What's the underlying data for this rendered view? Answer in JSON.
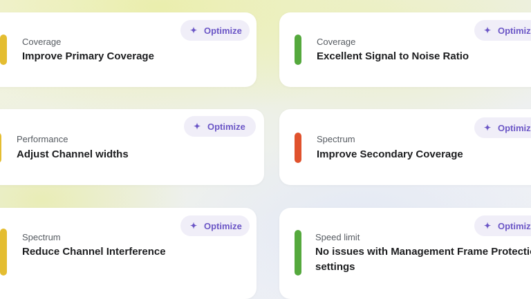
{
  "colors": {
    "yellow": "#e4bd31",
    "green": "#55a93d",
    "red": "#e0522d",
    "accent": "#6b56c6"
  },
  "optimize_icon": "sparkle-icon",
  "cards": [
    {
      "category": "Coverage",
      "title": "Improve Primary Coverage",
      "status": "yellow",
      "button": "Optimize"
    },
    {
      "category": "Coverage",
      "title": "Excellent Signal to Noise Ratio",
      "status": "green",
      "button": "Optimize"
    },
    {
      "category": "Performance",
      "title": "Adjust Channel widths",
      "status": "yellow",
      "button": "Optimize"
    },
    {
      "category": "Spectrum",
      "title": "Improve Secondary Coverage",
      "status": "red",
      "button": "Optimize"
    },
    {
      "category": "Spectrum",
      "title": "Reduce Channel Interference",
      "status": "yellow",
      "button": "Optimize"
    },
    {
      "category": "Speed limit",
      "title": "No issues with Management Frame Protection settings",
      "status": "green",
      "button": "Optimize"
    }
  ]
}
